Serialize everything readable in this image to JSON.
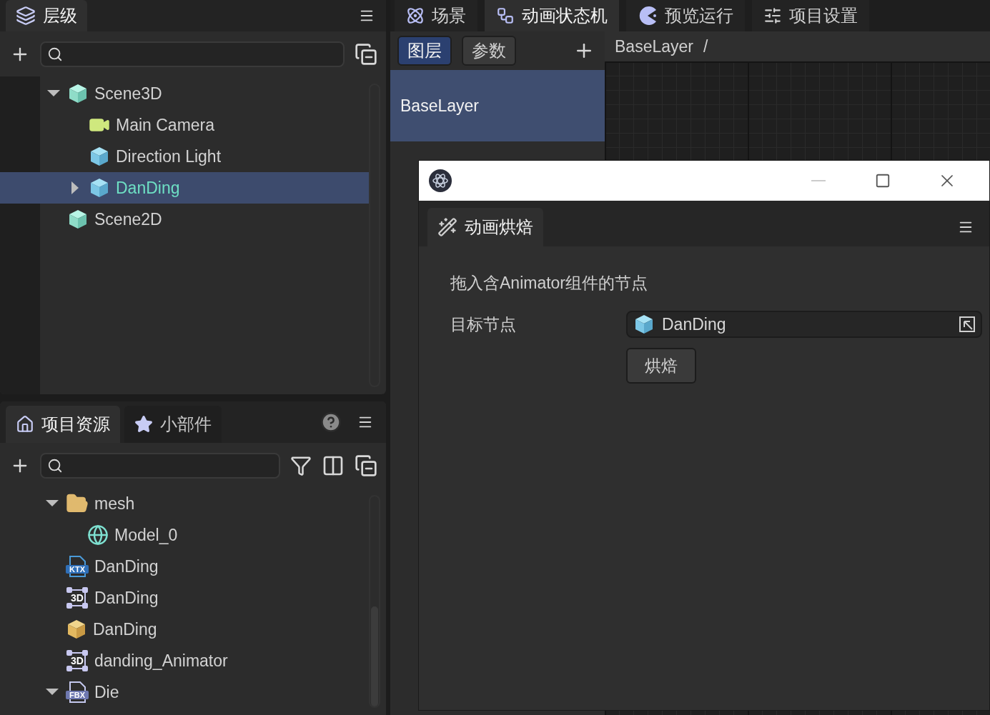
{
  "hierarchy": {
    "tab": {
      "label": "层级",
      "selected": true
    },
    "tree": [
      {
        "label": "Scene3D",
        "kind": "scene",
        "expanded": true,
        "selected": false,
        "children": [
          {
            "label": "Main Camera",
            "kind": "camera",
            "selected": false
          },
          {
            "label": "Direction Light",
            "kind": "sprite",
            "selected": false
          },
          {
            "label": "DanDing",
            "kind": "sprite",
            "expanded": false,
            "selected": true
          }
        ]
      },
      {
        "label": "Scene2D",
        "kind": "scene",
        "selected": false
      }
    ]
  },
  "assets": {
    "tabs": [
      {
        "label": "项目资源",
        "kind": "home",
        "selected": true
      },
      {
        "label": "小部件",
        "kind": "star",
        "selected": false
      }
    ],
    "tree": [
      {
        "label": "mesh",
        "kind": "folder",
        "expanded": true,
        "children": [
          {
            "label": "Model_0",
            "kind": "mesh"
          }
        ]
      },
      {
        "label": "DanDing",
        "kind": "texture",
        "badge": "KTX"
      },
      {
        "label": "DanDing",
        "kind": "model",
        "badge": "3D"
      },
      {
        "label": "DanDing",
        "kind": "prefab"
      },
      {
        "label": "danding_Animator",
        "kind": "model",
        "badge": "3D"
      },
      {
        "label": "Die",
        "kind": "fbx",
        "badge": "FBX",
        "expanded": true
      }
    ]
  },
  "editor": {
    "tabs": [
      {
        "label": "场景",
        "kind": "scene",
        "selected": false
      },
      {
        "label": "动画状态机",
        "kind": "graph",
        "selected": true
      },
      {
        "label": "预览运行",
        "kind": "preview",
        "selected": false
      },
      {
        "label": "项目设置",
        "kind": "settings",
        "selected": false
      }
    ],
    "subtabs": [
      {
        "label": "图层",
        "selected": true
      },
      {
        "label": "参数",
        "selected": false
      }
    ],
    "breadcrumb": {
      "path": "BaseLayer",
      "separator": "/"
    },
    "layers": [
      {
        "label": "BaseLayer",
        "selected": true
      }
    ]
  },
  "dialog": {
    "tab": {
      "label": "动画烘焙",
      "selected": true
    },
    "hint": "拖入含Animator组件的节点",
    "fields": [
      {
        "label": "目标节点",
        "value": "DanDing"
      }
    ],
    "button": "烘焙"
  }
}
